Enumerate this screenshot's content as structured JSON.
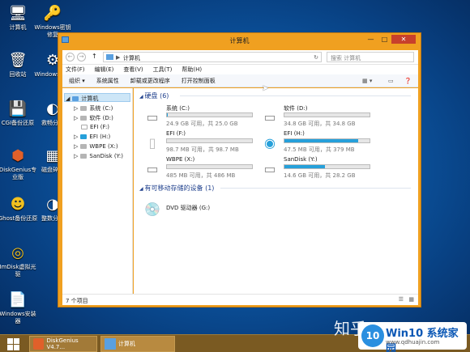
{
  "desktop": {
    "icons": [
      {
        "label": "计算机",
        "icon": "computer-icon"
      },
      {
        "label": "Windows密钥修复",
        "icon": "key-icon"
      },
      {
        "label": "回收站",
        "icon": "recycle-bin-icon"
      },
      {
        "label": "Windows恢复",
        "icon": "gear-icon"
      },
      {
        "label": "CGI备份还原",
        "icon": "cgi-icon"
      },
      {
        "label": "救畅分区",
        "icon": "partition-icon"
      },
      {
        "label": "DiskGenius专业版",
        "icon": "diskgenius-icon"
      },
      {
        "label": "磁盘碎片",
        "icon": "defrag-icon"
      },
      {
        "label": "Ghost备份还原",
        "icon": "ghost-icon"
      },
      {
        "label": "整数分区",
        "icon": "partition2-icon"
      },
      {
        "label": "ImDisk虚拟光驱",
        "icon": "imdisk-icon"
      },
      {
        "label": "Windows安装器",
        "icon": "installer-icon"
      }
    ]
  },
  "window": {
    "title": "计算机",
    "buttons": {
      "minimize": "—",
      "maximize": "□",
      "close": "✕"
    },
    "address": {
      "path_root": "▶",
      "path": "计算机",
      "search_placeholder": "搜索 计算机"
    },
    "menu": [
      "文件(F)",
      "编辑(E)",
      "查看(V)",
      "工具(T)",
      "帮助(H)"
    ],
    "commands": [
      "组织 ▾",
      "系统属性",
      "卸载或更改程序",
      "打开控制面板"
    ],
    "nav": {
      "root": "计算机",
      "items": [
        "系统 (C:)",
        "软件 (D:)",
        "EFI (F:)",
        "EFI (H:)",
        "WBPE (X:)",
        "SanDisk (Y:)"
      ]
    },
    "groups": {
      "hdd": "硬盘 (6)",
      "removable": "有可移动存储的设备 (1)"
    },
    "drives": [
      {
        "name": "系统 (C:)",
        "size": "24.9 GB 可用，共 25.0 GB",
        "used_fraction": 0.01,
        "icon": "hdd-icon"
      },
      {
        "name": "软件 (D:)",
        "size": "34.8 GB 可用，共 34.8 GB",
        "used_fraction": 0.0,
        "icon": "hdd-icon"
      },
      {
        "name": "EFI (F:)",
        "size": "98.7 MB 可用，共 98.7 MB",
        "used_fraction": 0.0,
        "icon": "file-icon"
      },
      {
        "name": "EFI (H:)",
        "size": "47.5 MB 可用，共 379 MB",
        "used_fraction": 0.87,
        "icon": "usb-drive-icon"
      },
      {
        "name": "WBPE (X:)",
        "size": "485 MB 可用，共 486 MB",
        "used_fraction": 0.0,
        "icon": "hdd-icon"
      },
      {
        "name": "SanDisk (Y:)",
        "size": "14.6 GB 可用，共 28.2 GB",
        "used_fraction": 0.48,
        "icon": "hdd-icon"
      }
    ],
    "dvd": {
      "name": "DVD 驱动器 (G:)"
    },
    "status": "7 个项目"
  },
  "taskbar": {
    "tasks": [
      "DiskGenius V4.7...",
      "计算机"
    ]
  },
  "watermark": {
    "text": "知乎",
    "brand_title": "Win10 系统家园",
    "brand_url": "www.qdhuajin.com"
  },
  "colors": {
    "window_frame": "#f0a020",
    "progress": "#26a0da",
    "taskbar": "#7a5a22"
  }
}
